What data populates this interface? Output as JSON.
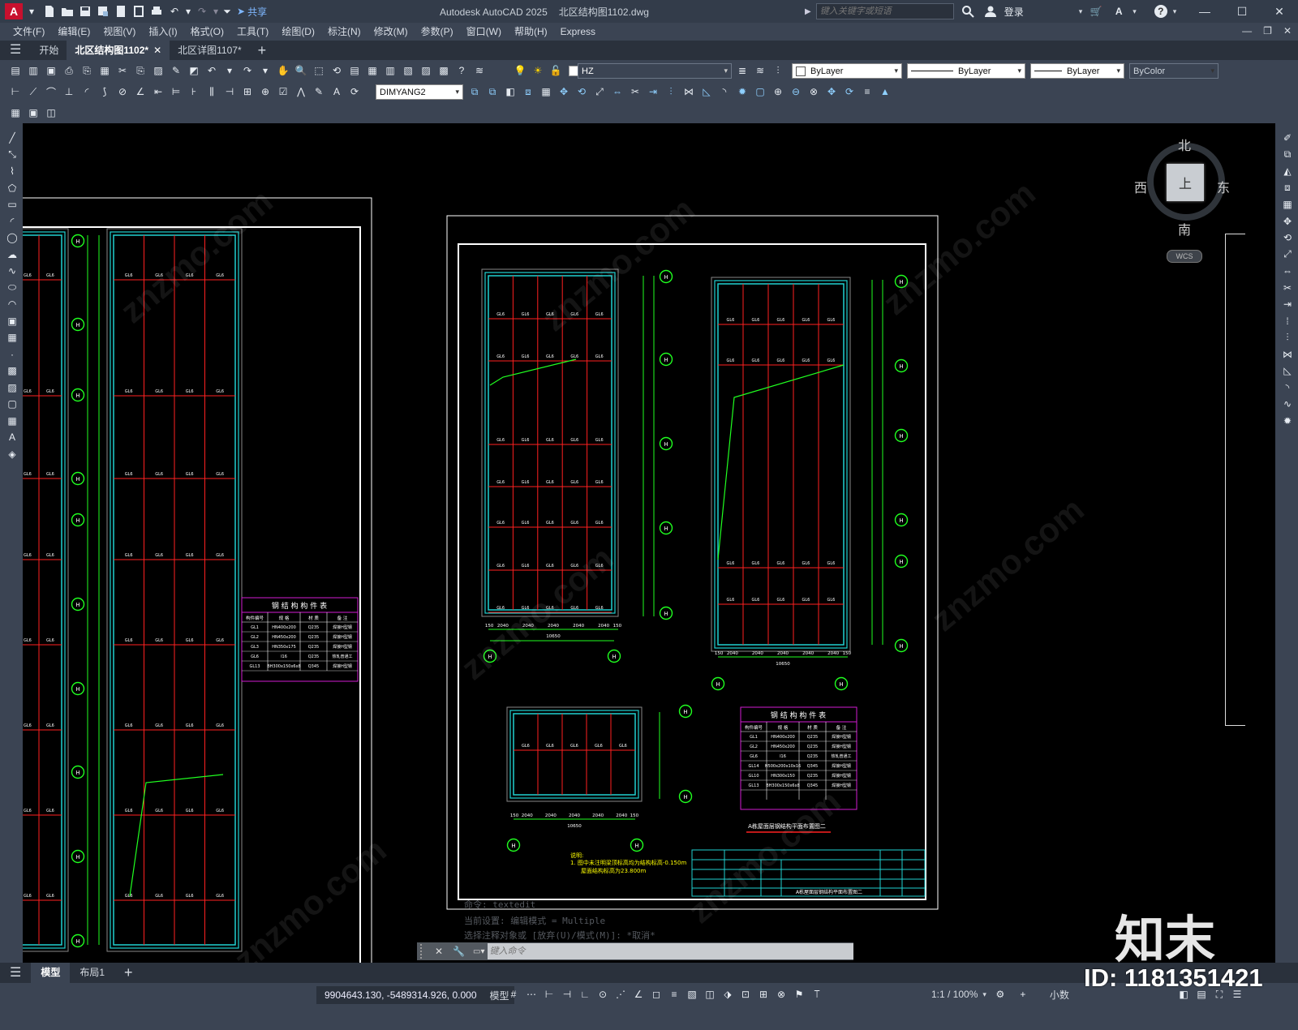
{
  "app": {
    "title": "Autodesk AutoCAD 2025",
    "filename": "北区结构图1102.dwg",
    "search_placeholder": "键入关键字或短语",
    "login": "登录",
    "share": "共享"
  },
  "menu": [
    "文件(F)",
    "编辑(E)",
    "视图(V)",
    "插入(I)",
    "格式(O)",
    "工具(T)",
    "绘图(D)",
    "标注(N)",
    "修改(M)",
    "参数(P)",
    "窗口(W)",
    "帮助(H)",
    "Express"
  ],
  "tabs": {
    "start": "开始",
    "active": "北区结构图1102*",
    "second": "北区详图1107*"
  },
  "props": {
    "layer": "HZ",
    "color": "ByLayer",
    "linetype": "ByLayer",
    "lineweight": "ByLayer",
    "plotstyle": "ByColor",
    "dimstyle": "DIMYANG2"
  },
  "viewcube": {
    "north": "北",
    "south": "南",
    "east": "东",
    "west": "西",
    "top": "上",
    "wcs": "WCS"
  },
  "command": {
    "line1": "命令:  textedit",
    "line2": "当前设置: 编辑模式 = Multiple",
    "line3": "选择注释对象或 [放弃(U)/模式(M)]: *取消*",
    "placeholder": "键入命令"
  },
  "layout_tabs": [
    "模型",
    "布局1"
  ],
  "status": {
    "coords": "9904643.130, -5489314.926, 0.000",
    "model": "模型",
    "scale": "1:1 / 100%",
    "units": "小数"
  },
  "drawing": {
    "table_title": "钢 结 构 构 件 表",
    "table_headers": [
      "构件编号",
      "规 格",
      "材 质",
      "备 注"
    ],
    "table_left_rows": [
      [
        "GL1",
        "HN400x200",
        "Q235",
        "焊接H型钢"
      ],
      [
        "GL2",
        "HN450x200",
        "Q235",
        "焊接H型钢"
      ],
      [
        "GL3",
        "HN350x175",
        "Q235",
        "焊接H型钢"
      ],
      [
        "GL6",
        "I16",
        "Q235",
        "热轧普通工"
      ],
      [
        "GL13",
        "BH300x150x6x8",
        "Q345",
        "焊接H型钢"
      ]
    ],
    "table_right_rows": [
      [
        "GL1",
        "HN400x200",
        "Q235",
        "焊接H型钢"
      ],
      [
        "GL2",
        "HN450x200",
        "Q235",
        "焊接H型钢"
      ],
      [
        "GL6",
        "I16",
        "Q235",
        "热轧普通工"
      ],
      [
        "GL14",
        "H500x200x10x16",
        "Q345",
        "焊接H型钢"
      ],
      [
        "GL10",
        "HN300x150",
        "Q235",
        "焊接H型钢"
      ],
      [
        "GL13",
        "BH300x150x6x8",
        "Q345",
        "焊接H型钢"
      ]
    ],
    "plan_caption": "A栋屋面层钢结构平面布置图二",
    "note_title": "说明:",
    "note_line1": "1. 图中未注明梁顶标高均为结构标高-0.150m",
    "note_line2": "屋面结构标高为23.800m",
    "dims_bottom": [
      "150",
      "2040",
      "2040",
      "2040",
      "2040",
      "2040",
      "150"
    ],
    "total_width": "10650",
    "watermark": "知末",
    "id_label": "ID: 1181351421"
  }
}
